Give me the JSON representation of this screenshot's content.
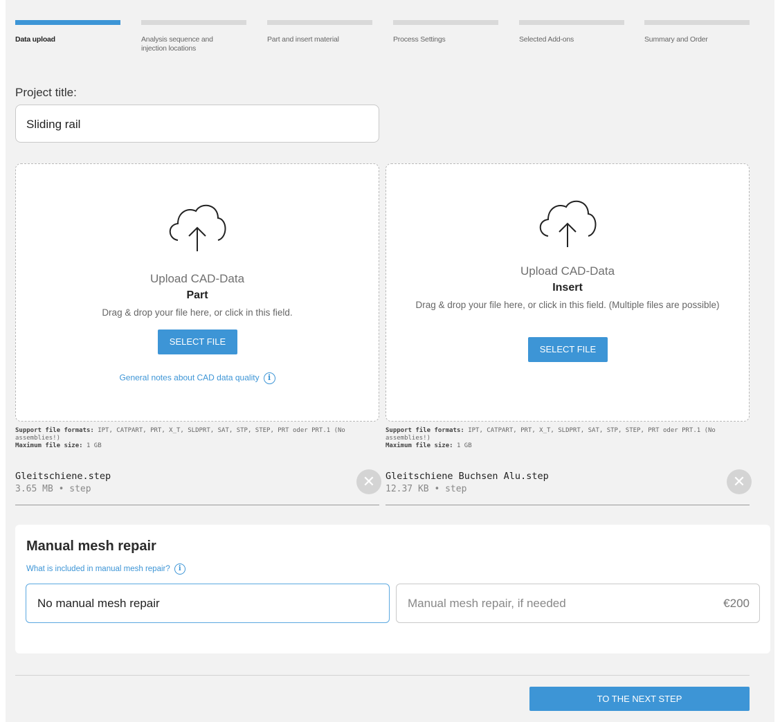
{
  "stepper": {
    "steps": [
      {
        "label": "Data upload",
        "active": true
      },
      {
        "label": "Analysis sequence and injection locations",
        "active": false
      },
      {
        "label": "Part and insert material",
        "active": false
      },
      {
        "label": "Process Settings",
        "active": false
      },
      {
        "label": "Selected Add-ons",
        "active": false
      },
      {
        "label": "Summary and Order",
        "active": false
      }
    ]
  },
  "project": {
    "label": "Project title:",
    "value": "Sliding rail"
  },
  "upload_part": {
    "icon": "cloud-upload-icon",
    "title": "Upload CAD-Data",
    "subtitle": "Part",
    "hint": "Drag & drop your file here, or click in this field.",
    "button": "SELECT FILE",
    "quality_link": "General notes about CAD data quality",
    "formats_label": "Support file formats:",
    "formats": "IPT, CATPART, PRT, X_T, SLDPRT, SAT, STP, STEP, PRT oder PRT.1 (No assemblies!)",
    "max_label": "Maximum file size:",
    "max": "1 GB",
    "file": {
      "name": "Gleitschiene.step",
      "meta": "3.65 MB • step"
    }
  },
  "upload_insert": {
    "icon": "cloud-upload-icon",
    "title": "Upload CAD-Data",
    "subtitle": "Insert",
    "hint": "Drag & drop your file here, or click in this field. (Multiple files are possible)",
    "button": "SELECT FILE",
    "formats_label": "Support file formats:",
    "formats": "IPT, CATPART, PRT, X_T, SLDPRT, SAT, STP, STEP, PRT oder PRT.1 (No assemblies!)",
    "max_label": "Maximum file size:",
    "max": "1 GB",
    "file": {
      "name": "Gleitschiene Buchsen Alu.step",
      "meta": "12.37 KB • step"
    }
  },
  "mesh": {
    "title": "Manual mesh repair",
    "link": "What is included in manual mesh repair?",
    "options": [
      {
        "label": "No manual mesh repair",
        "selected": true
      },
      {
        "label": "Manual mesh repair, if needed",
        "price": "€200",
        "selected": false
      }
    ]
  },
  "footer": {
    "next_button": "TO THE NEXT STEP"
  },
  "colors": {
    "accent": "#3d95d6",
    "background": "#f2f2f2"
  }
}
